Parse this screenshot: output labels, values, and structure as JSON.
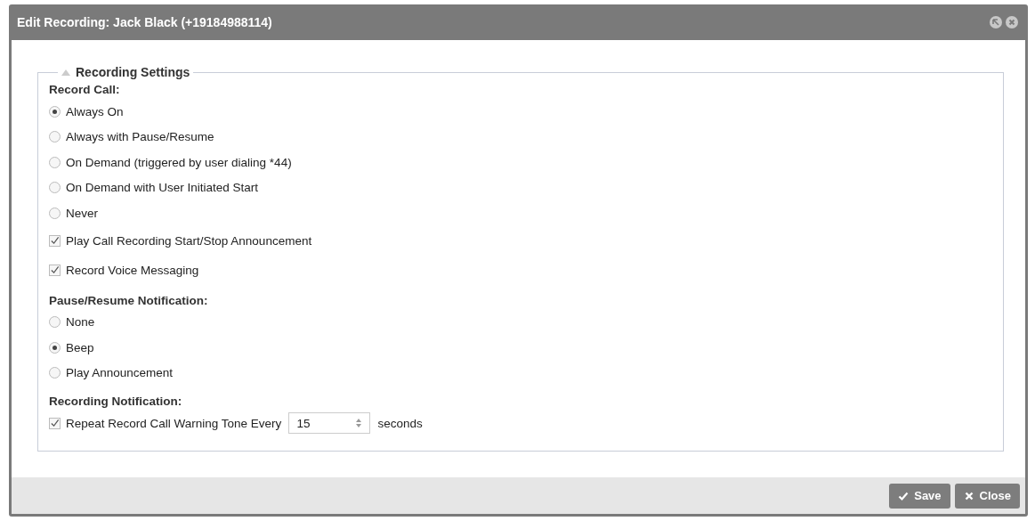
{
  "window": {
    "title": "Edit Recording: Jack Black (+19184988114)"
  },
  "fieldset": {
    "legend": "Recording Settings",
    "expanded": true,
    "items": [
      {
        "kind": "heading",
        "label": "Record Call:"
      },
      {
        "kind": "radio",
        "label": "Always On",
        "selected": true
      },
      {
        "kind": "radio",
        "label": "Always with Pause/Resume",
        "selected": false
      },
      {
        "kind": "radio",
        "label": "On Demand (triggered by user dialing *44)",
        "selected": false
      },
      {
        "kind": "radio",
        "label": "On Demand with User Initiated Start",
        "selected": false
      },
      {
        "kind": "radio",
        "label": "Never",
        "selected": false
      },
      {
        "kind": "checkbox",
        "label": "Play Call Recording Start/Stop Announcement",
        "checked": true
      },
      {
        "kind": "checkbox",
        "label": "Record Voice Messaging",
        "checked": true
      },
      {
        "kind": "heading",
        "label": "Pause/Resume Notification:"
      },
      {
        "kind": "radio",
        "label": "None",
        "selected": false
      },
      {
        "kind": "radio",
        "label": "Beep",
        "selected": true
      },
      {
        "kind": "radio",
        "label": "Play Announcement",
        "selected": false
      },
      {
        "kind": "heading",
        "label": "Recording Notification:"
      },
      {
        "kind": "number-row",
        "label": "Repeat Record Call Warning Tone Every",
        "checked": true,
        "value": "15",
        "unit": "seconds"
      }
    ]
  },
  "buttons": [
    "Save",
    "Close"
  ]
}
